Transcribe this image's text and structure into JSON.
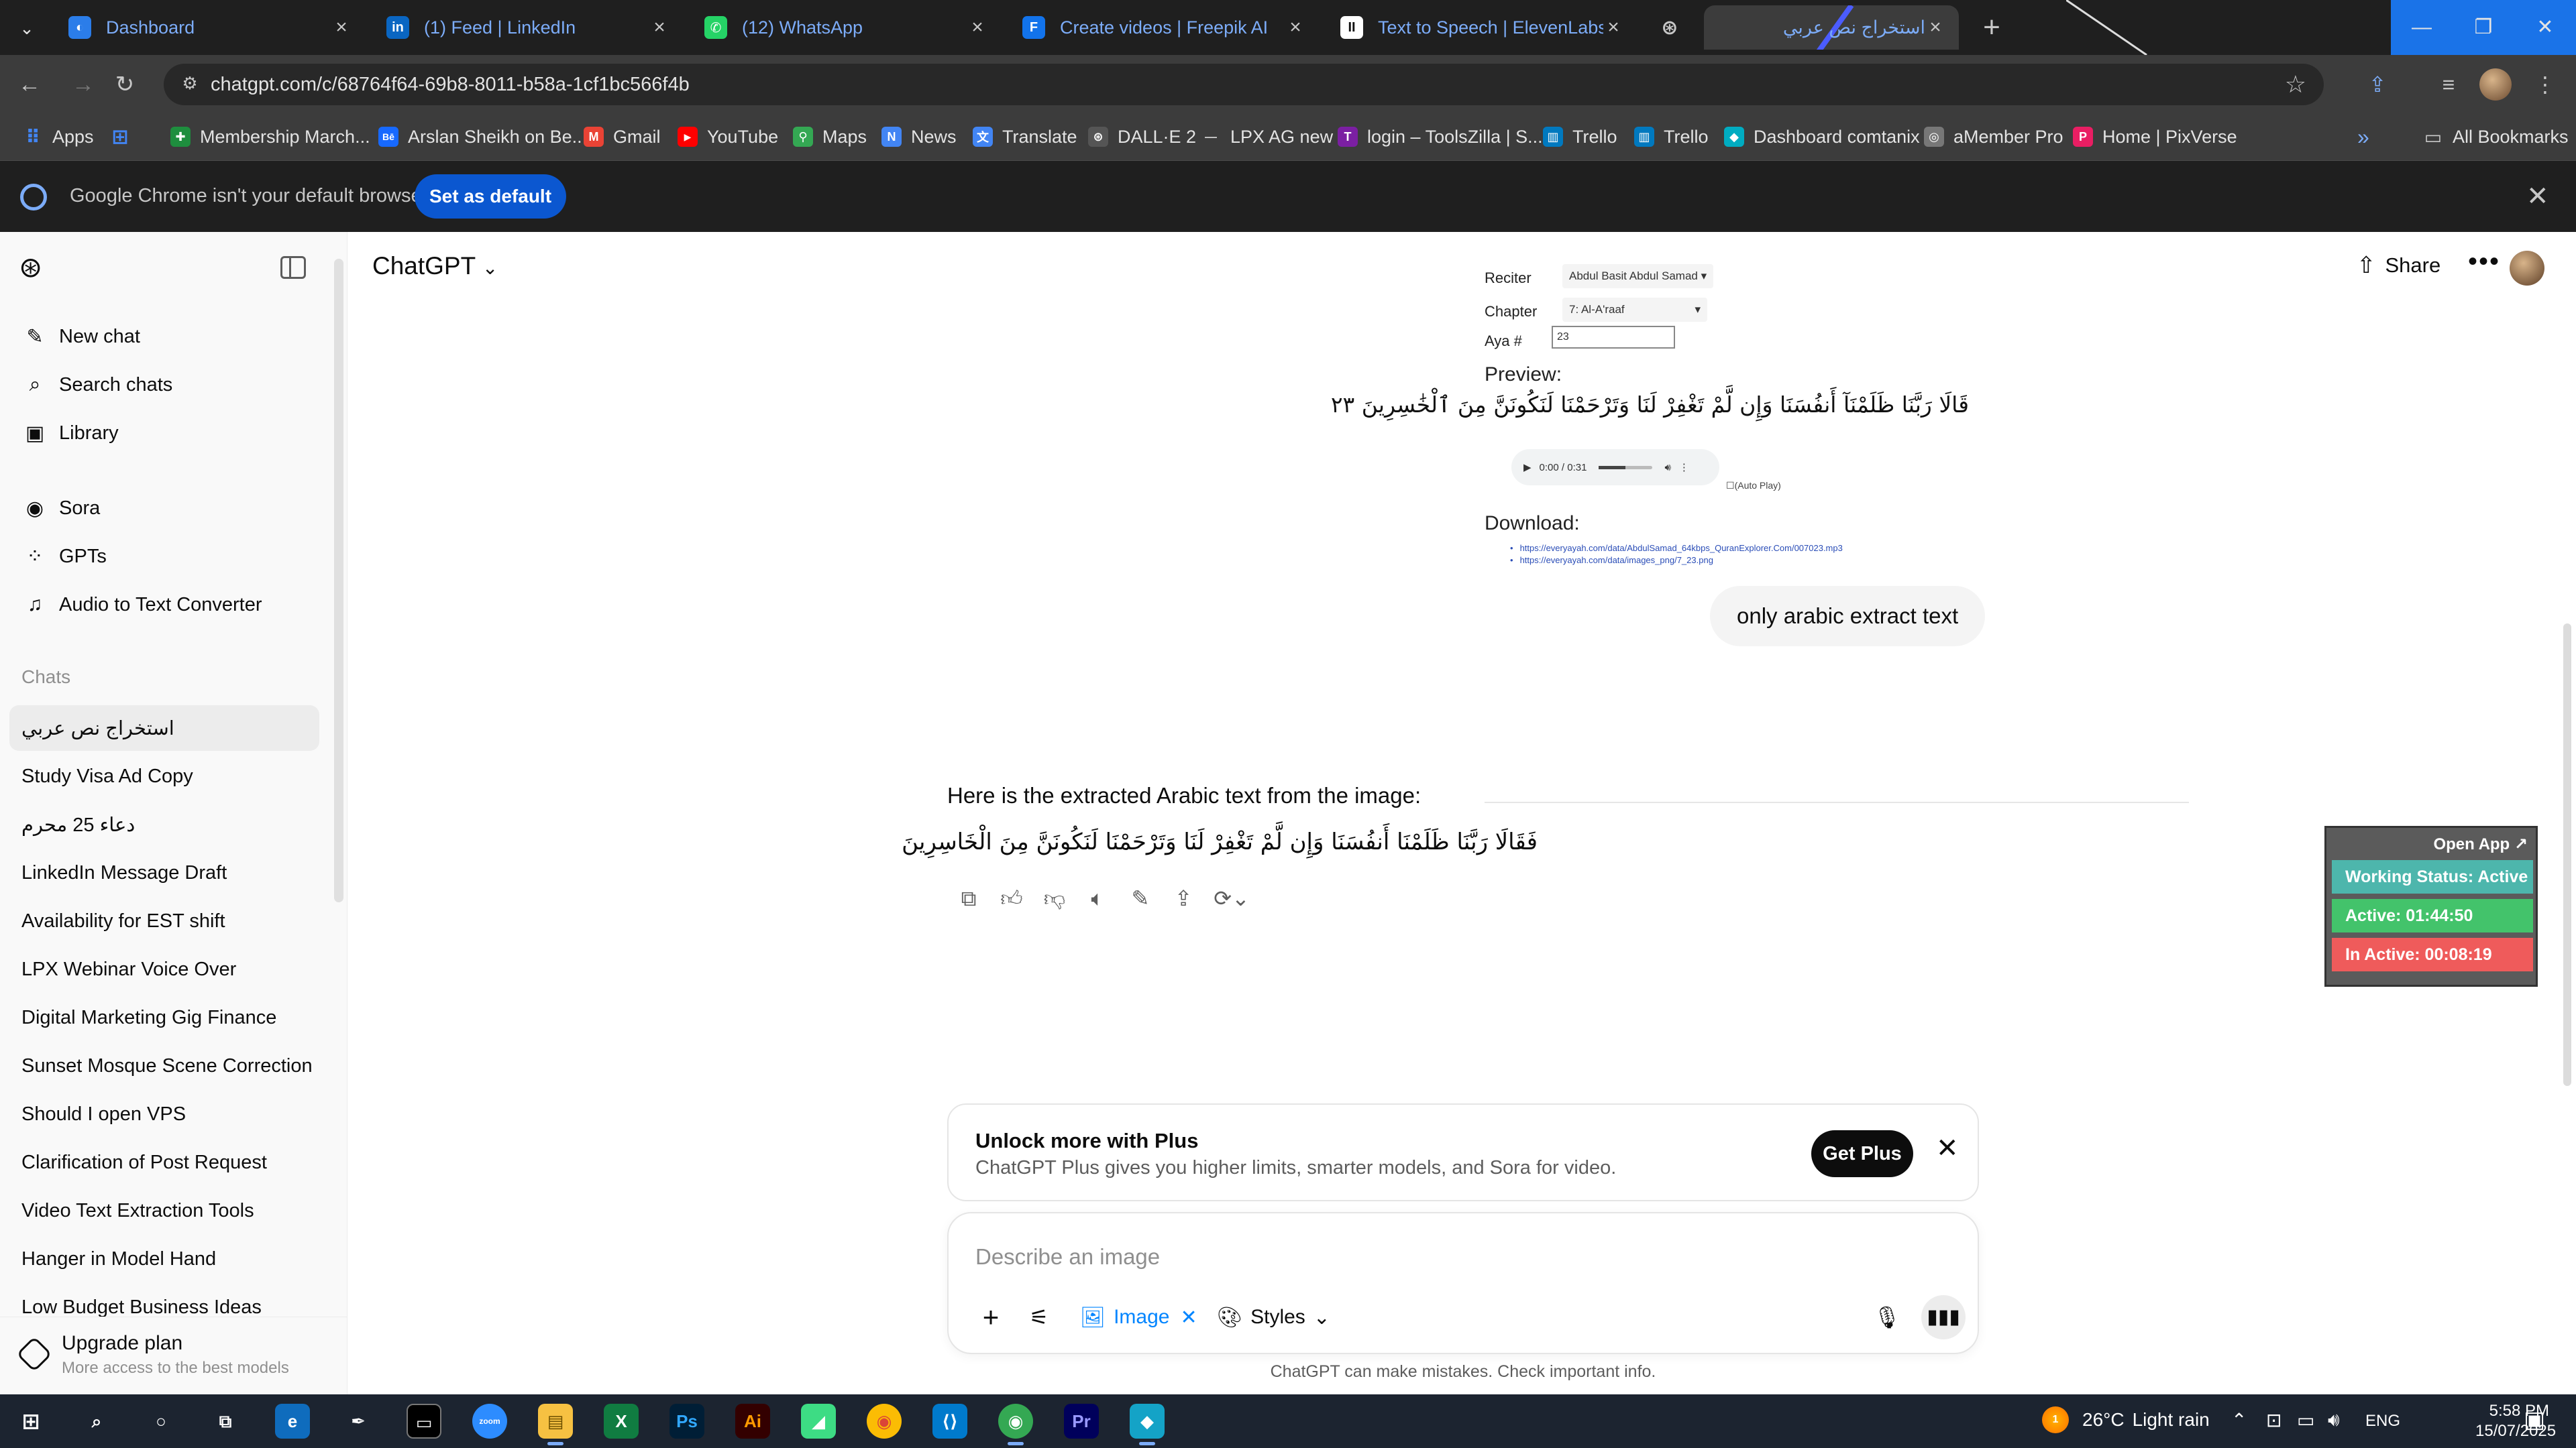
{
  "browser": {
    "tabs": [
      {
        "label": "Dashboard",
        "icon": "dashboard-icon",
        "color": "#2b7de9",
        "glyph": "◐"
      },
      {
        "label": "(1) Feed | LinkedIn",
        "icon": "linkedin-icon",
        "color": "#0a66c2",
        "glyph": "in"
      },
      {
        "label": "(12) WhatsApp",
        "icon": "whatsapp-icon",
        "color": "#25d366",
        "glyph": "✆"
      },
      {
        "label": "Create videos | Freepik AI",
        "icon": "freepik-icon",
        "color": "#1273eb",
        "glyph": "F"
      },
      {
        "label": "Text to Speech | ElevenLabs",
        "icon": "elevenlabs-icon",
        "color": "#ffffff",
        "glyph": "II"
      },
      {
        "label": "",
        "icon": "chatgpt-tab-icon",
        "color": "#3c3c3c",
        "glyph": "⊛"
      },
      {
        "label": "استخراج نص عربي",
        "icon": "active-tab-icon",
        "color": "#3c3c3c",
        "glyph": ""
      }
    ],
    "url": "chatgpt.com/c/68764f64-69b8-8011-b58a-1cf1bc566f4b",
    "bookmarks": [
      {
        "label": "Apps",
        "icon": "apps-icon",
        "color": "#4285f4",
        "glyph": "⠿"
      },
      {
        "label": "",
        "icon": "grid-icon",
        "color": "#4285f4",
        "glyph": "⊞"
      },
      {
        "label": "Membership March...",
        "icon": "membership-icon",
        "color": "#1e8e3e",
        "glyph": "✚"
      },
      {
        "label": "Arslan Sheikh on Be...",
        "icon": "behance-icon",
        "color": "#1769ff",
        "glyph": "Bē"
      },
      {
        "label": "Gmail",
        "icon": "gmail-icon",
        "color": "#ea4335",
        "glyph": "M"
      },
      {
        "label": "YouTube",
        "icon": "youtube-icon",
        "color": "#ff0000",
        "glyph": "▶"
      },
      {
        "label": "Maps",
        "icon": "maps-icon",
        "color": "#34a853",
        "glyph": "⚲"
      },
      {
        "label": "News",
        "icon": "news-icon",
        "color": "#4285f4",
        "glyph": "N"
      },
      {
        "label": "Translate",
        "icon": "translate-icon",
        "color": "#4285f4",
        "glyph": "文"
      },
      {
        "label": "DALL·E 2",
        "icon": "dalle-icon",
        "color": "#555555",
        "glyph": "⊛"
      },
      {
        "label": "LPX AG new",
        "icon": "lpx-icon",
        "color": "#3c3c3c",
        "glyph": "—"
      },
      {
        "label": "login – ToolsZilla | S...",
        "icon": "toolszilla-icon",
        "color": "#7b1fa2",
        "glyph": "T"
      },
      {
        "label": "Trello",
        "icon": "trello-icon",
        "color": "#0079bf",
        "glyph": "▥"
      },
      {
        "label": "Trello",
        "icon": "trello-icon",
        "color": "#0079bf",
        "glyph": "▥"
      },
      {
        "label": "Dashboard comtanix",
        "icon": "comtanix-icon",
        "color": "#00acc1",
        "glyph": "◆"
      },
      {
        "label": "aMember Pro",
        "icon": "amember-icon",
        "color": "#777777",
        "glyph": "◎"
      },
      {
        "label": "Home | PixVerse",
        "icon": "pixverse-icon",
        "color": "#e91e63",
        "glyph": "P"
      }
    ],
    "all_bookmarks": "All Bookmarks"
  },
  "infobar": {
    "text": "Google Chrome isn't your default browser",
    "button": "Set as default"
  },
  "sidebar": {
    "nav": [
      {
        "label": "New chat",
        "icon": "edit-icon",
        "glyph": "✎"
      },
      {
        "label": "Search chats",
        "icon": "search-icon",
        "glyph": "⌕"
      },
      {
        "label": "Library",
        "icon": "library-icon",
        "glyph": "▣"
      },
      {
        "label": "Sora",
        "icon": "sora-icon",
        "glyph": "◉"
      },
      {
        "label": "GPTs",
        "icon": "gpts-icon",
        "glyph": "⁘"
      },
      {
        "label": "Audio to Text Converter",
        "icon": "audio-gpt-icon",
        "glyph": "♫"
      }
    ],
    "chats_heading": "Chats",
    "chats": [
      "استخراج نص عربي",
      "Study Visa Ad Copy",
      "دعاء 25 محرم",
      "LinkedIn Message Draft",
      "Availability for EST shift",
      "LPX Webinar Voice Over",
      "Digital Marketing Gig Finance",
      "Sunset Mosque Scene Correction",
      "Should I open VPS",
      "Clarification of Post Request",
      "Video Text Extraction Tools",
      "Hanger in Model Hand",
      "Low Budget Business Ideas"
    ],
    "upgrade_title": "Upgrade plan",
    "upgrade_sub": "More access to the best models"
  },
  "header": {
    "model": "ChatGPT",
    "share": "Share"
  },
  "uploaded_image": {
    "reciter_label": "Reciter",
    "reciter_value": "Abdul Basit Abdul Samad",
    "chapter_label": "Chapter",
    "chapter_value": "7: Al-A'raaf",
    "aya_label": "Aya #",
    "aya_value": "23",
    "preview_label": "Preview:",
    "arabic_verse": "قَالَا رَبَّنَا ظَلَمْنَآ أَنفُسَنَا وَإِن لَّمْ تَغْفِرْ لَنَا وَتَرْحَمْنَا لَنَكُونَنَّ مِنَ ٱلْخَٰسِرِينَ ٢٣",
    "player_time": "0:00 / 0:31",
    "autoplay": "(Auto Play)",
    "download_label": "Download:",
    "links": [
      "https://everyayah.com/data/AbdulSamad_64kbps_QuranExplorer.Com/007023.mp3",
      "https://everyayah.com/data/images_png/7_23.png"
    ]
  },
  "conversation": {
    "user_message": "only arabic extract text",
    "reply_lead": "Here is the extracted Arabic text from the image:",
    "reply_arabic": "فَقَالَا رَبَّنَا ظَلَمْنَا أَنفُسَنَا وَإِن لَّمْ تَغْفِرْ لَنَا وَتَرْحَمْنَا لَنَكُونَنَّ مِنَ الْخَاسِرِينَ"
  },
  "work_status": {
    "open_app": "Open App ↗",
    "status": "Working Status: Active",
    "active": "Active: 01:44:50",
    "inactive": "In Active: 00:08:19",
    "colors": {
      "status": "#4db6ac",
      "active": "#43c36b",
      "inactive": "#ef5b5b"
    }
  },
  "promo": {
    "title": "Unlock more with Plus",
    "subtitle": "ChatGPT Plus gives you higher limits, smarter models, and Sora for video.",
    "button": "Get Plus"
  },
  "composer": {
    "placeholder": "Describe an image",
    "image_chip": "Image",
    "styles": "Styles",
    "disclaimer": "ChatGPT can make mistakes. Check important info."
  },
  "taskbar": {
    "weather_temp": "26°C",
    "weather_desc": "Light rain",
    "weather_badge": "1",
    "lang": "ENG",
    "time": "5:58 PM",
    "date": "15/07/2025"
  }
}
